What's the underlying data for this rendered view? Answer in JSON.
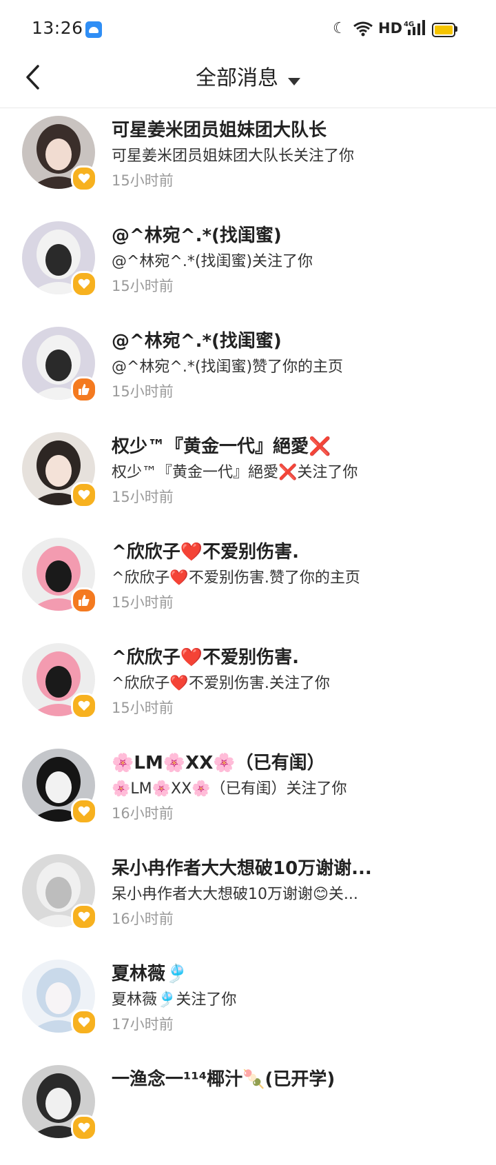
{
  "status_bar": {
    "time": "13:26",
    "network": "HD",
    "cellular": "4G"
  },
  "header": {
    "title": "全部消息"
  },
  "notifications": [
    {
      "name": "可星姜米团员姐妹团大队长",
      "message": "可星姜米团员姐妹团大队长关注了你",
      "time": "15小时前",
      "type": "follow",
      "avatar_colors": [
        "#c9c3c0",
        "#3a2e2a",
        "#f1dcd1"
      ]
    },
    {
      "name": "@^林宛^.*(找闺蜜)",
      "message": "@^林宛^.*(找闺蜜)关注了你",
      "time": "15小时前",
      "type": "follow",
      "avatar_colors": [
        "#d9d6e3",
        "#f2f2f2",
        "#2a2a2a"
      ]
    },
    {
      "name": "@^林宛^.*(找闺蜜)",
      "message": "@^林宛^.*(找闺蜜)赞了你的主页",
      "time": "15小时前",
      "type": "like",
      "avatar_colors": [
        "#d9d6e3",
        "#f2f2f2",
        "#2a2a2a"
      ]
    },
    {
      "name": "权少™『黄金一代』絕愛❌",
      "message": "权少™『黄金一代』絕愛❌关注了你",
      "time": "15小时前",
      "type": "follow",
      "avatar_colors": [
        "#e6e1dc",
        "#2d2623",
        "#f4e2d8"
      ]
    },
    {
      "name": "^欣欣子❤️不爱别伤害.",
      "message": "^欣欣子❤️不爱别伤害.赞了你的主页",
      "time": "15小时前",
      "type": "like",
      "avatar_colors": [
        "#ededed",
        "#f39bb0",
        "#1a1a1a"
      ]
    },
    {
      "name": "^欣欣子❤️不爱别伤害.",
      "message": "^欣欣子❤️不爱别伤害.关注了你",
      "time": "15小时前",
      "type": "follow",
      "avatar_colors": [
        "#ededed",
        "#f39bb0",
        "#1a1a1a"
      ]
    },
    {
      "name": "🌸LM🌸XX🌸（已有闺）",
      "message": "🌸LM🌸XX🌸（已有闺）关注了你",
      "time": "16小时前",
      "type": "follow",
      "avatar_colors": [
        "#c4c6ca",
        "#151515",
        "#f2f2f2"
      ]
    },
    {
      "name": "呆小冉作者大大想破10万谢谢...",
      "message": "呆小冉作者大大想破10万谢谢😊关...",
      "time": "16小时前",
      "type": "follow",
      "avatar_colors": [
        "#dadada",
        "#f0f0f0",
        "#bdbdbd"
      ]
    },
    {
      "name": "夏林薇🎐",
      "message": "夏林薇🎐关注了你",
      "time": "17小时前",
      "type": "follow",
      "avatar_colors": [
        "#eef2f7",
        "#c9d9ea",
        "#f7f4f6"
      ]
    },
    {
      "name": "一渔念一¹¹⁴椰汁🍡(已开学)",
      "message": "",
      "time": "",
      "type": "follow",
      "avatar_colors": [
        "#cfcfcf",
        "#2a2a2a",
        "#f0f0f0"
      ]
    }
  ],
  "icons": {
    "back": "back-arrow-icon",
    "dropdown": "caret-down-icon",
    "follow_badge": "heart-icon",
    "like_badge": "thumbs-up-icon"
  },
  "colors": {
    "follow_badge": "#f7b11f",
    "like_badge": "#f47a20",
    "time_text": "#9a9a9a"
  }
}
